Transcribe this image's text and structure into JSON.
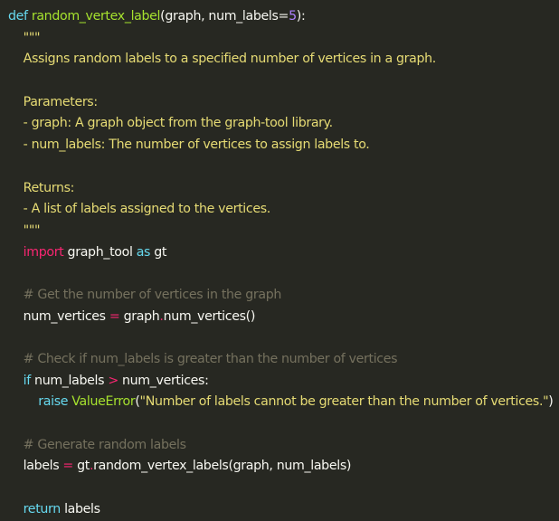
{
  "colors": {
    "background": "#272822",
    "keyword": "#66d9ef",
    "function": "#a6e22e",
    "number": "#ae81ff",
    "string": "#e6db74",
    "comment": "#75715e",
    "operator": "#f92672",
    "plain": "#f8f8f2"
  },
  "code": {
    "lines": [
      [
        {
          "type": "kw",
          "text": "def"
        },
        {
          "type": "plain",
          "text": " "
        },
        {
          "type": "fn",
          "text": "random_vertex_label"
        },
        {
          "type": "plain",
          "text": "(graph, num_labels="
        },
        {
          "type": "num",
          "text": "5"
        },
        {
          "type": "plain",
          "text": "):"
        }
      ],
      [
        {
          "type": "str",
          "text": "    \"\"\""
        }
      ],
      [
        {
          "type": "str",
          "text": "    Assigns random labels to a specified number of vertices in a graph."
        }
      ],
      [],
      [
        {
          "type": "str",
          "text": "    Parameters:"
        }
      ],
      [
        {
          "type": "str",
          "text": "    - graph: A graph object from the graph-tool library."
        }
      ],
      [
        {
          "type": "str",
          "text": "    - num_labels: The number of vertices to assign labels to."
        }
      ],
      [],
      [
        {
          "type": "str",
          "text": "    Returns:"
        }
      ],
      [
        {
          "type": "str",
          "text": "    - A list of labels assigned to the vertices."
        }
      ],
      [
        {
          "type": "str",
          "text": "    \"\"\""
        }
      ],
      [
        {
          "type": "plain",
          "text": "    "
        },
        {
          "type": "op",
          "text": "import"
        },
        {
          "type": "plain",
          "text": " graph_tool "
        },
        {
          "type": "kw",
          "text": "as"
        },
        {
          "type": "plain",
          "text": " gt"
        }
      ],
      [],
      [
        {
          "type": "cm",
          "text": "    # Get the number of vertices in the graph"
        }
      ],
      [
        {
          "type": "plain",
          "text": "    num_vertices "
        },
        {
          "type": "op",
          "text": "="
        },
        {
          "type": "plain",
          "text": " graph"
        },
        {
          "type": "op",
          "text": "."
        },
        {
          "type": "plain",
          "text": "num_vertices()"
        }
      ],
      [],
      [
        {
          "type": "cm",
          "text": "    # Check if num_labels is greater than the number of vertices"
        }
      ],
      [
        {
          "type": "plain",
          "text": "    "
        },
        {
          "type": "kw",
          "text": "if"
        },
        {
          "type": "plain",
          "text": " num_labels "
        },
        {
          "type": "op",
          "text": ">"
        },
        {
          "type": "plain",
          "text": " num_vertices:"
        }
      ],
      [
        {
          "type": "plain",
          "text": "        "
        },
        {
          "type": "kw",
          "text": "raise"
        },
        {
          "type": "plain",
          "text": " "
        },
        {
          "type": "cls",
          "text": "ValueError"
        },
        {
          "type": "plain",
          "text": "("
        },
        {
          "type": "str",
          "text": "\"Number of labels cannot be greater than the number of vertices.\""
        },
        {
          "type": "plain",
          "text": ")"
        }
      ],
      [],
      [
        {
          "type": "cm",
          "text": "    # Generate random labels"
        }
      ],
      [
        {
          "type": "plain",
          "text": "    labels "
        },
        {
          "type": "op",
          "text": "="
        },
        {
          "type": "plain",
          "text": " gt"
        },
        {
          "type": "op",
          "text": "."
        },
        {
          "type": "plain",
          "text": "random_vertex_labels(graph, num_labels)"
        }
      ],
      [],
      [
        {
          "type": "plain",
          "text": "    "
        },
        {
          "type": "kw",
          "text": "return"
        },
        {
          "type": "plain",
          "text": " labels"
        }
      ]
    ]
  }
}
